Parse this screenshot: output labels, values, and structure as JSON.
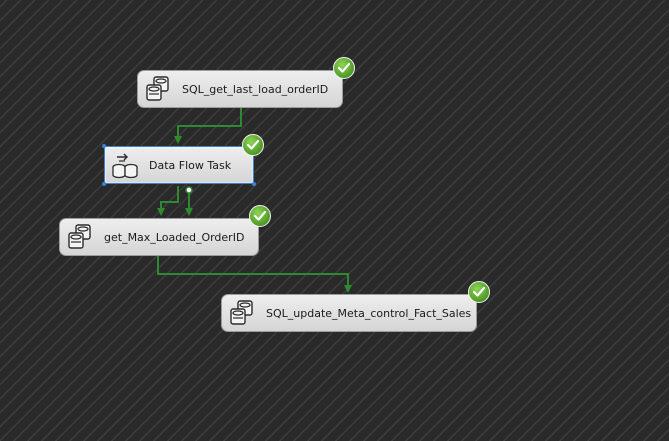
{
  "tasks": [
    {
      "id": "t1",
      "label": "SQL_get_last_load_orderID",
      "icon": "execute-sql-icon",
      "status": "success"
    },
    {
      "id": "t2",
      "label": "Data Flow Task",
      "icon": "data-flow-icon",
      "status": "success",
      "selected": true
    },
    {
      "id": "t3",
      "label": "get_Max_Loaded_OrderID",
      "icon": "execute-sql-icon",
      "status": "success"
    },
    {
      "id": "t4",
      "label": "SQL_update_Meta_control_Fact_Sales",
      "icon": "execute-sql-icon",
      "status": "success"
    }
  ],
  "colors": {
    "connector": "#2f8a2f",
    "success": "#5aac2e",
    "selection": "#3c82d4",
    "background": "#2a2a2a"
  }
}
